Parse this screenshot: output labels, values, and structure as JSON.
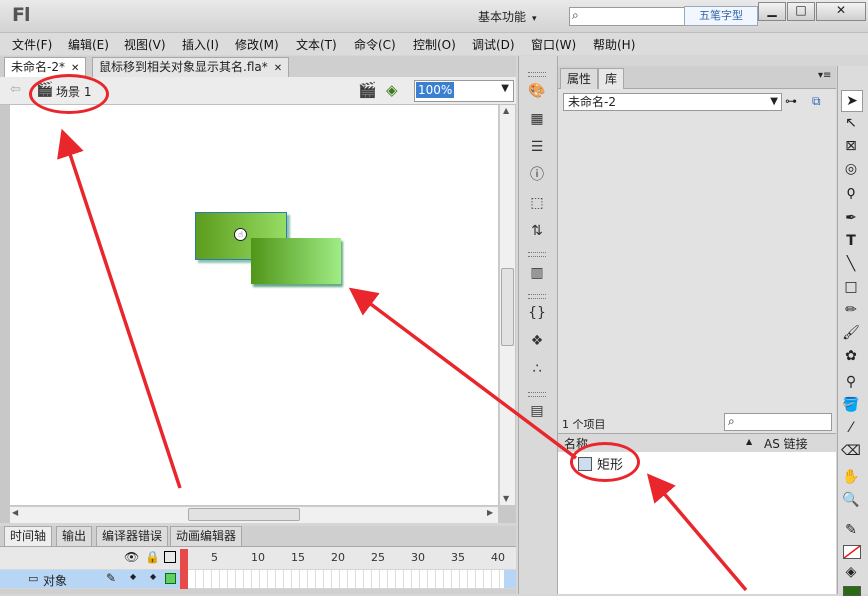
{
  "app": {
    "logo": "Fl",
    "workspace": "基本功能",
    "watermark": "五笔字型",
    "window_controls": [
      "minimize-icon",
      "maximize-icon",
      "close-icon"
    ]
  },
  "menu": [
    "文件(F)",
    "编辑(E)",
    "视图(V)",
    "插入(I)",
    "修改(M)",
    "文本(T)",
    "命令(C)",
    "控制(O)",
    "调试(D)",
    "窗口(W)",
    "帮助(H)"
  ],
  "doc_tabs": [
    {
      "label": "未命名-2*",
      "active": true
    },
    {
      "label": "鼠标移到相关对象显示其名.fla*",
      "active": false
    }
  ],
  "editbar": {
    "scene": "场景 1",
    "zoom": "100%"
  },
  "timeline": {
    "tabs": [
      "时间轴",
      "输出",
      "编译器错误",
      "动画编辑器"
    ],
    "frame_numbers": [
      "1",
      "5",
      "10",
      "15",
      "20",
      "25",
      "30",
      "35",
      "40"
    ],
    "layer_name": "对象"
  },
  "library": {
    "tabs": [
      "属性",
      "库"
    ],
    "document": "未命名-2",
    "count": "1 个项目",
    "col_name": "名称",
    "col_linkage": "AS 链接",
    "items": [
      "矩形"
    ]
  },
  "colors": {
    "annotation": "#e8262c",
    "accent": "#3b7fd1",
    "shape": "#6fb83a"
  }
}
